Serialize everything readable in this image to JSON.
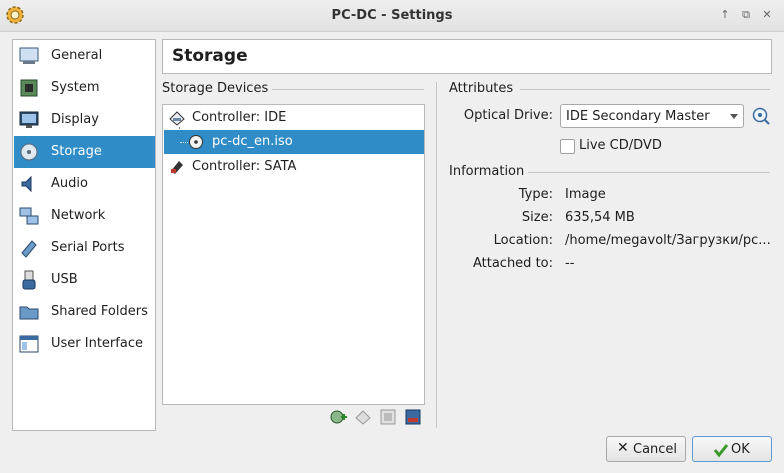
{
  "window": {
    "title": "PC-DC - Settings"
  },
  "sidebar": {
    "items": [
      {
        "label": "General",
        "icon": "general-icon"
      },
      {
        "label": "System",
        "icon": "system-icon"
      },
      {
        "label": "Display",
        "icon": "display-icon"
      },
      {
        "label": "Storage",
        "icon": "storage-icon",
        "selected": true
      },
      {
        "label": "Audio",
        "icon": "audio-icon"
      },
      {
        "label": "Network",
        "icon": "network-icon"
      },
      {
        "label": "Serial Ports",
        "icon": "serial-ports-icon"
      },
      {
        "label": "USB",
        "icon": "usb-icon"
      },
      {
        "label": "Shared Folders",
        "icon": "shared-folders-icon"
      },
      {
        "label": "User Interface",
        "icon": "user-interface-icon"
      }
    ]
  },
  "page": {
    "title": "Storage"
  },
  "storage_devices": {
    "header": "Storage Devices",
    "tree": [
      {
        "label": "Controller: IDE",
        "type": "controller",
        "icon": "ide-controller-icon"
      },
      {
        "label": "pc-dc_en.iso",
        "type": "attachment",
        "icon": "optical-disc-icon",
        "selected": true
      },
      {
        "label": "Controller: SATA",
        "type": "controller",
        "icon": "sata-controller-icon"
      }
    ],
    "toolbar": [
      "add-attachment-icon",
      "remove-attachment-icon",
      "add-controller-icon",
      "remove-controller-icon"
    ]
  },
  "attributes": {
    "header": "Attributes",
    "optical_drive_label": "Optical Drive:",
    "optical_drive_value": "IDE Secondary Master",
    "live_cd_label": "Live CD/DVD",
    "live_cd_checked": false
  },
  "information": {
    "header": "Information",
    "type_label": "Type:",
    "type_value": "Image",
    "size_label": "Size:",
    "size_value": "635,54 MB",
    "location_label": "Location:",
    "location_value": "/home/megavolt/Загрузки/pc...",
    "attached_label": "Attached to:",
    "attached_value": "--"
  },
  "buttons": {
    "cancel": "Cancel",
    "ok": "OK"
  },
  "colors": {
    "selection": "#308cc6",
    "ok_icon": "#3a9a2a",
    "cancel_icon": "#333333"
  }
}
